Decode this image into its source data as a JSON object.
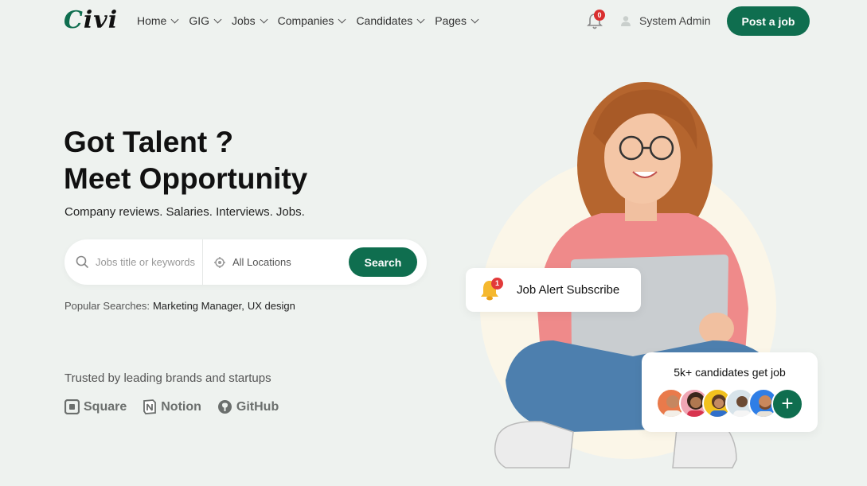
{
  "header": {
    "logo": "Civi",
    "nav": [
      "Home",
      "GIG",
      "Jobs",
      "Companies",
      "Candidates",
      "Pages"
    ],
    "notification_count": "0",
    "user_name": "System Admin",
    "post_job_label": "Post a job"
  },
  "hero": {
    "title_line1": "Got Talent ?",
    "title_line2": "Meet Opportunity",
    "subtitle": "Company reviews. Salaries. Interviews. Jobs."
  },
  "search": {
    "keyword_placeholder": "Jobs title or keywords",
    "location_value": "All Locations",
    "button_label": "Search"
  },
  "popular": {
    "label": "Popular Searches:",
    "tags": [
      "Marketing Manager,",
      "UX design"
    ]
  },
  "trusted": {
    "label": "Trusted by leading brands and startups",
    "brands": [
      "Square",
      "Notion",
      "GitHub"
    ]
  },
  "alert_card": {
    "badge": "1",
    "label": "Job Alert Subscribe"
  },
  "candidates_card": {
    "label": "5k+ candidates get job",
    "plus": "+"
  },
  "colors": {
    "accent": "#0f6e4f",
    "background": "#eef2ef",
    "badge": "#d92f2f"
  }
}
